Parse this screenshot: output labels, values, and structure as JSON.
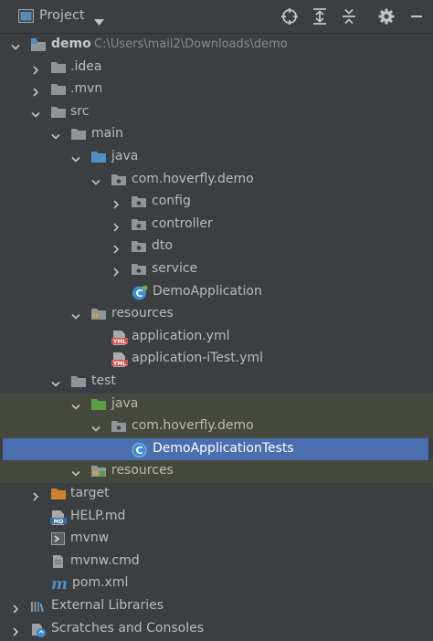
{
  "header": {
    "title": "Project"
  },
  "tree": {
    "demo": {
      "label": "demo",
      "path": "C:\\Users\\mail2\\Downloads\\demo"
    },
    "idea": "idea",
    "mvn": ".mvn",
    "src": "src",
    "main": "main",
    "main_java": "java",
    "main_pkg": "com.hoverfly.demo",
    "config": "config",
    "controller": "controller",
    "dto": "dto",
    "service": "service",
    "demo_application": "DemoApplication",
    "main_resources": "resources",
    "application_yml": "application.yml",
    "application_itest_yml": "application-iTest.yml",
    "test": "test",
    "test_java": "java",
    "test_pkg": "com.hoverfly.demo",
    "demo_application_tests": "DemoApplicationTests",
    "test_resources": "resources",
    "target": "target",
    "help_md": "HELP.md",
    "mvnw": "mvnw",
    "mvnw_cmd": "mvnw.cmd",
    "pom_xml": "pom.xml",
    "external_libraries": "External Libraries",
    "scratches": "Scratches and Consoles"
  },
  "icons": {
    "yml_badge": "YML",
    "md_badge": "MD",
    "maven_glyph": "m"
  },
  "colors": {
    "background": "#3c3f41",
    "selection": "#4b6eaf",
    "test_background": "#45483f",
    "folder_gray": "#8f9598",
    "folder_blue": "#4e8fc7",
    "folder_green": "#5e9b45",
    "folder_orange": "#d0812f",
    "class_blue": "#3e8ed0"
  }
}
